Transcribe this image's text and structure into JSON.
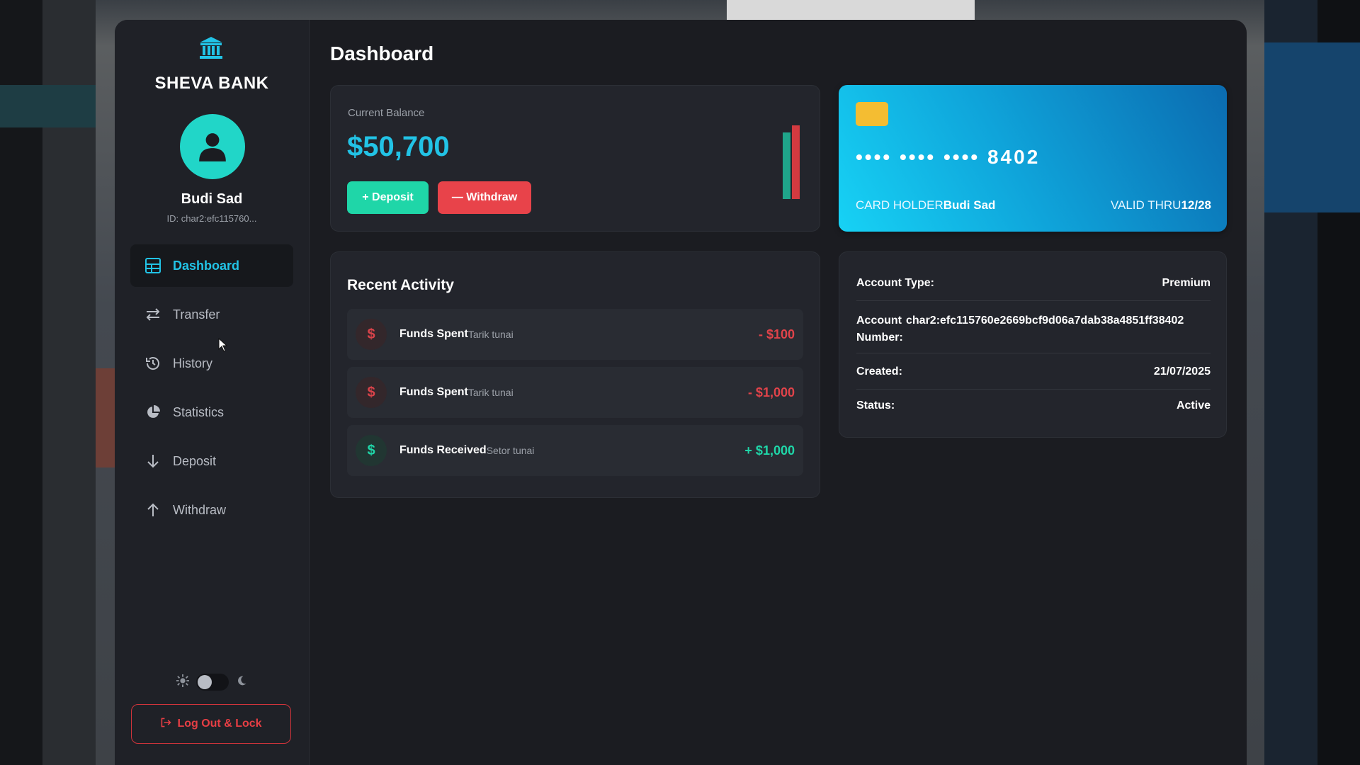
{
  "bank": {
    "name": "SHEVA BANK"
  },
  "user": {
    "name": "Budi Sad",
    "id": "ID: char2:efc115760..."
  },
  "sidebar": {
    "items": [
      {
        "label": "Dashboard",
        "icon": "grid-icon",
        "active": true
      },
      {
        "label": "Transfer",
        "icon": "swap-icon"
      },
      {
        "label": "History",
        "icon": "history-icon"
      },
      {
        "label": "Statistics",
        "icon": "pie-chart-icon"
      },
      {
        "label": "Deposit",
        "icon": "arrow-down-icon"
      },
      {
        "label": "Withdraw",
        "icon": "arrow-up-icon"
      }
    ],
    "logout_label": "Log Out & Lock"
  },
  "main": {
    "title": "Dashboard",
    "balance": {
      "label": "Current Balance",
      "value": "$50,700",
      "deposit_label": "+ Deposit",
      "withdraw_label": "— Withdraw"
    },
    "card": {
      "number": "•••• •••• •••• 8402",
      "holder_label": "CARD HOLDER",
      "holder_name": "Budi Sad",
      "valid_label": "VALID THRU",
      "valid_value": "12/28"
    },
    "activity": {
      "title": "Recent Activity",
      "items": [
        {
          "name": "Funds Spent",
          "sub": "Tarik tunai",
          "amount": "- $100",
          "type": "neg"
        },
        {
          "name": "Funds Spent",
          "sub": "Tarik tunai",
          "amount": "- $1,000",
          "type": "neg"
        },
        {
          "name": "Funds Received",
          "sub": "Setor tunai",
          "amount": "+ $1,000",
          "type": "pos"
        }
      ]
    },
    "account": {
      "type_label": "Account Type:",
      "type_value": "Premium",
      "number_label_1": "Account",
      "number_label_2": "Number:",
      "number_value": "char2:efc115760e2669bcf9d06a7dab38a4851ff38402",
      "created_label": "Created:",
      "created_value": "21/07/2025",
      "status_label": "Status:",
      "status_value": "Active"
    }
  },
  "colors": {
    "accent": "#22c3e6",
    "positive": "#1fd6a8",
    "negative": "#e8434a"
  }
}
